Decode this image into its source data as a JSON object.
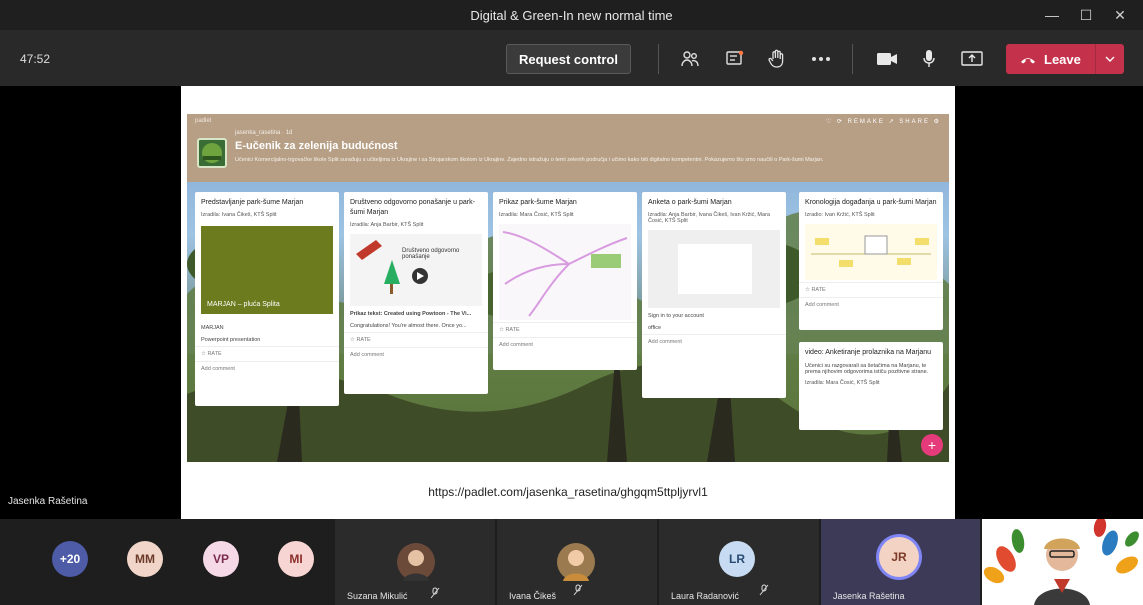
{
  "window": {
    "title": "Digital & Green-In new normal time",
    "controls": [
      "—",
      "☐",
      "✕"
    ]
  },
  "toolbar": {
    "timer": "47:52",
    "request_control": "Request control",
    "leave": "Leave",
    "icons": [
      "participants-icon",
      "chat-icon",
      "raise-hand-icon",
      "more-icon",
      "camera-icon",
      "mic-icon",
      "share-screen-icon"
    ]
  },
  "stage": {
    "presenter_name": "Jasenka Rašetina",
    "slide_url": "https://padlet.com/jasenka_rasetina/ghgqm5ttpljyrvl1",
    "padlet": {
      "brand": "padlet",
      "owner_line": "jasenka_rasetina · 1d",
      "title": "E-učenik za zelenija budućnost",
      "description": "Učenici Komercijalno-trgovačke škole Split surađuju s učiteljima iz Ukrajine i sa Strojarskom školom iz Ukrajine. Zajedno istražuju o temi zelenih područja i učimo kako biti digitalno kompetentni. Pokazujemo što smo naučili o Park-šumi Marjan.",
      "actions": "♡  ⟳ REMAKE  ↗ SHARE  ⚙",
      "columns": [
        {
          "title": "Predstavljanje park-šume Marjan",
          "author": "Izradila: Ivana Čikeš, KTŠ Split",
          "caption": "MARJAN – pluća Splita",
          "meta": "MARJAN",
          "meta2": "Powerpoint presentation",
          "rate": "☆ RATE",
          "comment": "Add comment"
        },
        {
          "title": "Društveno odgovorno ponašanje u park-šumi Marjan",
          "author": "Izradila: Anja Barbir, KTŠ Split",
          "caption": "Društveno odgovorno ponašanje",
          "meta": "Prikaz tekst: Created using Powtoon - The Vi...",
          "meta2": "Congratulations! You're almost there. Once yo...",
          "rate": "☆ RATE",
          "comment": "Add comment"
        },
        {
          "title": "Prikaz park-šume Marjan",
          "author": "Izradila: Mara Čosić, KTŠ Split",
          "caption": "",
          "meta": "",
          "meta2": "",
          "rate": "☆ RATE",
          "comment": "Add comment"
        },
        {
          "title": "Anketa o park-šumi Marjan",
          "author": "Izradila: Anja Barbir, Ivana Čikeš, Ivan Kržić, Mara Čosić, KTŠ Split",
          "caption": "",
          "meta": "Sign in to your account",
          "meta2": "office",
          "rate": "",
          "comment": "Add comment"
        },
        {
          "title": "Kronologija događanja u park-šumi Marjan",
          "author": "Izradio: Ivan Kržić, KTŠ Split",
          "caption": "",
          "meta": "",
          "meta2": "",
          "rate": "☆ RATE",
          "comment": "Add comment"
        },
        {
          "title": "video: Anketiranje prolaznika na Marjanu",
          "author": "Izradila: Mara Čosić, KTŠ Split",
          "caption": "Učenici su razgovarali sa šetačima na Marjanu, te prema njihovim odgovorima ističu pozitivne strane.",
          "meta": "",
          "meta2": "",
          "rate": "",
          "comment": ""
        }
      ]
    }
  },
  "participants": {
    "overflow": "+20",
    "avatars": [
      {
        "initials": "MM",
        "color": "#f1d5c9",
        "text": "#6b3a2a"
      },
      {
        "initials": "VP",
        "color": "#f6d9e7",
        "text": "#7a2c4f"
      },
      {
        "initials": "MI",
        "color": "#f6d5d2",
        "text": "#8a2f2b"
      }
    ],
    "tiles": [
      {
        "name": "Suzana Mikulić",
        "mic": "muted-mic-icon"
      },
      {
        "name": "Ivana Čikeš",
        "mic": "muted-mic-icon"
      },
      {
        "name": "Laura Radanović",
        "initials": "LR",
        "mic": "muted-mic-icon"
      },
      {
        "name": "Jasenka Rašetina",
        "initials": "JR"
      }
    ]
  }
}
